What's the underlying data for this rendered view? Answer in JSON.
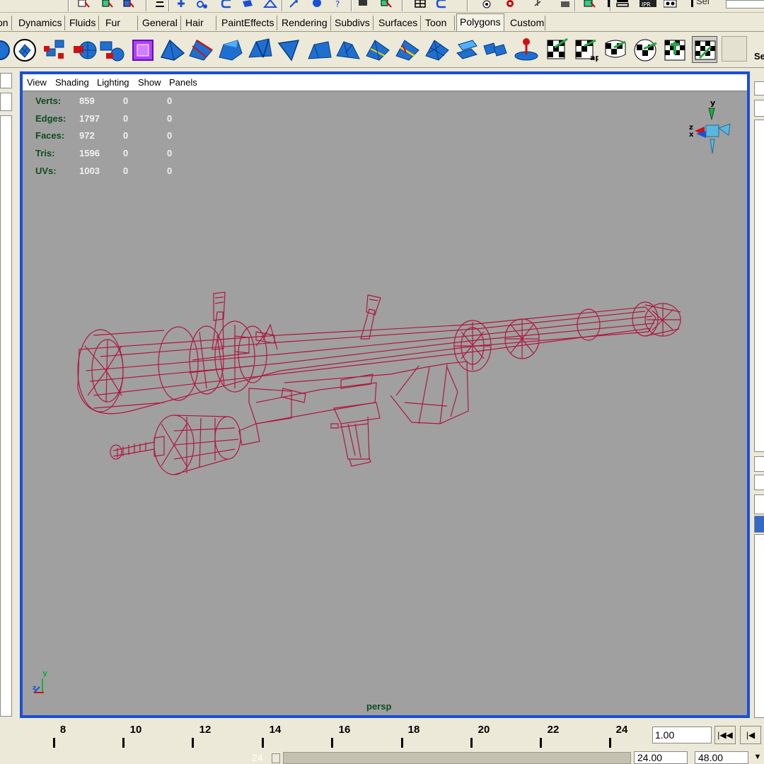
{
  "top_toolbar": {
    "select_label": "Sel"
  },
  "shelf": {
    "tabs": [
      {
        "label": "on"
      },
      {
        "label": "Dynamics"
      },
      {
        "label": "Fluids"
      },
      {
        "label": "Fur"
      },
      {
        "label": "General"
      },
      {
        "label": "Hair"
      },
      {
        "label": "PaintEffects"
      },
      {
        "label": "Rendering"
      },
      {
        "label": "Subdivs"
      },
      {
        "label": "Surfaces"
      },
      {
        "label": "Toon"
      },
      {
        "label": "Polygons"
      },
      {
        "label": "Custom"
      }
    ],
    "active_tab": "Polygons",
    "side_label": "Se",
    "icons": [
      "sphere-icon",
      "split-polygon-icon",
      "extract-icon",
      "combine-icon",
      "separate-icon",
      "cube-icon",
      "extrude-face-icon",
      "extrude-edge-icon",
      "bevel-icon",
      "poke-icon",
      "wedge-icon",
      "chamfer-icon",
      "merge-vertex-icon",
      "append-polygon-icon",
      "split-edge-icon",
      "subdivide-icon",
      "duplicate-face-icon",
      "smooth-icon",
      "sculpt-icon",
      "planar-map-icon",
      "cylindrical-map-icon",
      "spherical-map-icon",
      "automatic-map-icon",
      "texture-editor-icon",
      "layout-uvs-icon"
    ]
  },
  "viewport": {
    "menu": [
      "View",
      "Shading",
      "Lighting",
      "Show",
      "Panels"
    ],
    "hud": [
      {
        "label": "Verts:",
        "values": [
          "859",
          "0",
          "0"
        ]
      },
      {
        "label": "Edges:",
        "values": [
          "1797",
          "0",
          "0"
        ]
      },
      {
        "label": "Faces:",
        "values": [
          "972",
          "0",
          "0"
        ]
      },
      {
        "label": "Tris:",
        "values": [
          "1596",
          "0",
          "0"
        ]
      },
      {
        "label": "UVs:",
        "values": [
          "1003",
          "0",
          "0"
        ]
      }
    ],
    "camera": "persp",
    "axis_labels": {
      "x": "x",
      "y": "y",
      "z": "z"
    },
    "wireframe_color": "#b0173f",
    "background_color": "#a0a0a0",
    "frame_color": "#1a50d8"
  },
  "time_slider": {
    "ticks": [
      "8",
      "10",
      "12",
      "14",
      "16",
      "18",
      "20",
      "22",
      "24"
    ],
    "current_time": "1.00"
  },
  "range_slider": {
    "handle_value": "24",
    "range_end": "24.00",
    "anim_end": "48.00"
  }
}
